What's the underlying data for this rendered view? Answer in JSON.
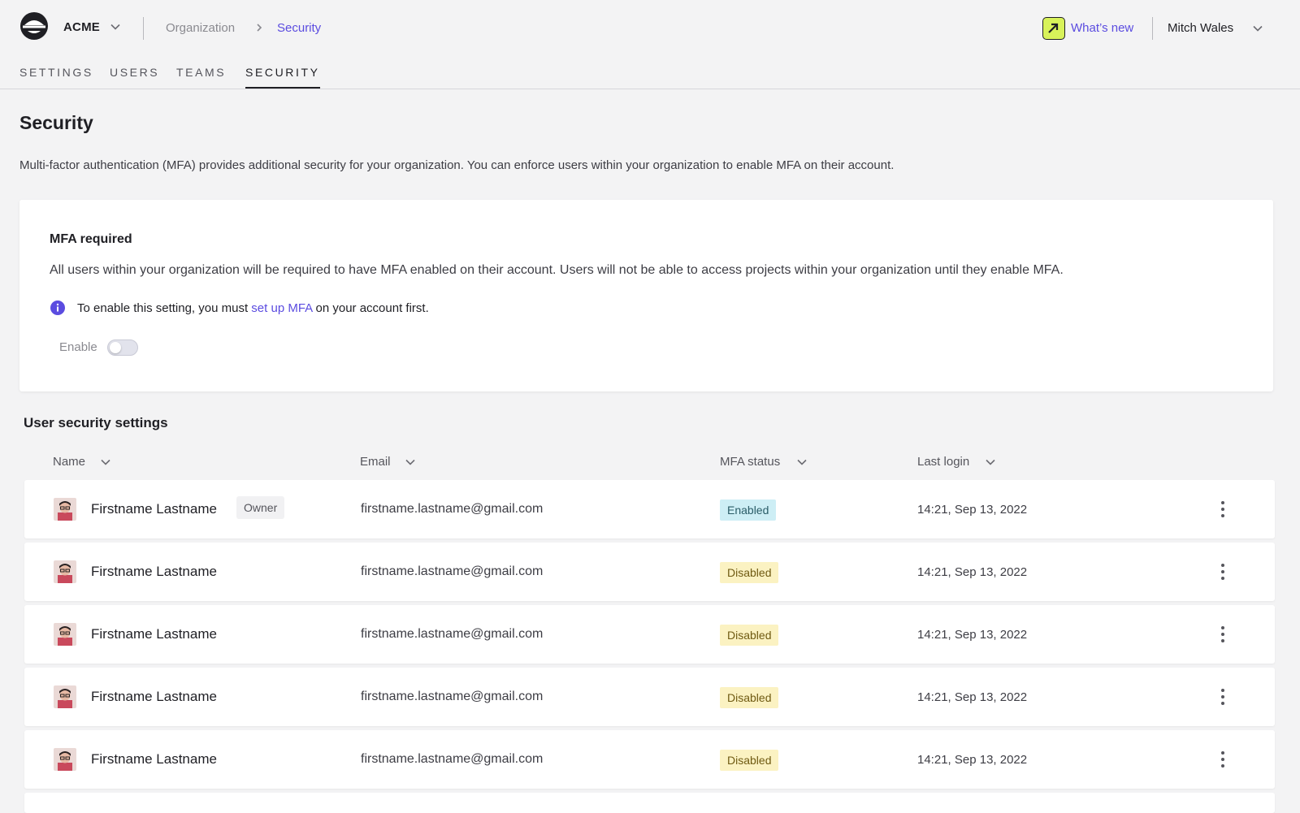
{
  "header": {
    "org_name": "ACME",
    "breadcrumb": {
      "parent": "Organization",
      "current": "Security"
    },
    "whats_new": "What’s new",
    "user_name": "Mitch Wales"
  },
  "tabs": [
    {
      "label": "SETTINGS",
      "active": false
    },
    {
      "label": "USERS",
      "active": false
    },
    {
      "label": "TEAMS",
      "active": false
    },
    {
      "label": "SECURITY",
      "active": true
    }
  ],
  "page": {
    "title": "Security",
    "description": "Multi-factor authentication (MFA) provides additional security for your organization. You can enforce users within your organization to enable MFA on their account."
  },
  "mfa_card": {
    "title": "MFA required",
    "description": "All users within your organization will be required to have MFA enabled on their account. Users will not be able to access projects within your organization until they enable MFA.",
    "info_prefix": "To enable this setting, you must ",
    "info_link": "set up MFA",
    "info_suffix": " on your account first.",
    "enable_label": "Enable",
    "enabled": false
  },
  "user_security": {
    "title": "User security settings",
    "columns": {
      "name": "Name",
      "email": "Email",
      "mfa_status": "MFA status",
      "last_login": "Last login"
    },
    "rows": [
      {
        "name": "Firstname Lastname",
        "badge": "Owner",
        "email": "firstname.lastname@gmail.com",
        "mfa_status": "Enabled",
        "last_login": "14:21, Sep 13, 2022"
      },
      {
        "name": "Firstname Lastname",
        "badge": "",
        "email": "firstname.lastname@gmail.com",
        "mfa_status": "Disabled",
        "last_login": "14:21, Sep 13, 2022"
      },
      {
        "name": "Firstname Lastname",
        "badge": "",
        "email": "firstname.lastname@gmail.com",
        "mfa_status": "Disabled",
        "last_login": "14:21, Sep 13, 2022"
      },
      {
        "name": "Firstname Lastname",
        "badge": "",
        "email": "firstname.lastname@gmail.com",
        "mfa_status": "Disabled",
        "last_login": "14:21, Sep 13, 2022"
      },
      {
        "name": "Firstname Lastname",
        "badge": "",
        "email": "firstname.lastname@gmail.com",
        "mfa_status": "Disabled",
        "last_login": "14:21, Sep 13, 2022"
      }
    ]
  },
  "colors": {
    "accent": "#5b4ce0",
    "whats_new_icon_bg": "#d8f25a",
    "status_enabled_bg": "#cdeef5",
    "status_disabled_bg": "#fbf2c2"
  },
  "icons": {
    "logo": "acme-logo-icon",
    "chevron": "chevron-down-icon",
    "breadcrumb_separator": "chevron-right-icon",
    "whats_new": "arrow-up-right-icon",
    "info": "info-icon",
    "row_menu": "kebab-menu-icon",
    "avatar": "avatar"
  }
}
